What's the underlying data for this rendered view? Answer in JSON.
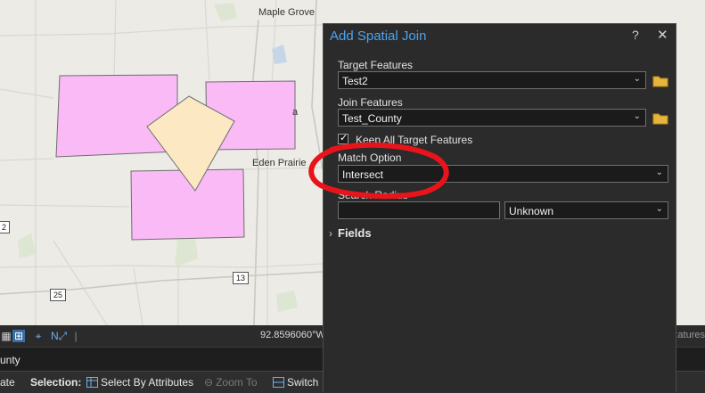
{
  "map": {
    "labels": {
      "maple_grove": "Maple Grove",
      "eden_prairie": "Eden Prairie",
      "partial_a": "a",
      "hwy_25": "25",
      "hwy_13": "13",
      "hwy_2": "2"
    },
    "colors": {
      "county_fill": "#f9baf5",
      "diamond_fill": "#fde8c4",
      "outline": "#777777"
    }
  },
  "dialog": {
    "title": "Add Spatial Join",
    "help": "?",
    "close": "✕",
    "target_features_label": "Target Features",
    "target_features_value": "Test2",
    "join_features_label": "Join Features",
    "join_features_value": "Test_County",
    "keep_all_label": "Keep All Target Features",
    "match_option_label": "Match Option",
    "match_option_value": "Intersect",
    "search_radius_label": "Search Radius",
    "search_radius_value": "",
    "search_radius_unit": "Unknown",
    "fields_label": "Fields",
    "annotation_color": "#e8141b"
  },
  "status": {
    "coordinate": "92.8596060°W",
    "features": "atures:"
  },
  "table": {
    "tab_name": "unty"
  },
  "toolbar": {
    "partial_left": "ate",
    "selection_label": "Selection:",
    "select_by_attributes": "Select By Attributes",
    "zoom_to": "Zoom To",
    "switch": "Switch"
  }
}
